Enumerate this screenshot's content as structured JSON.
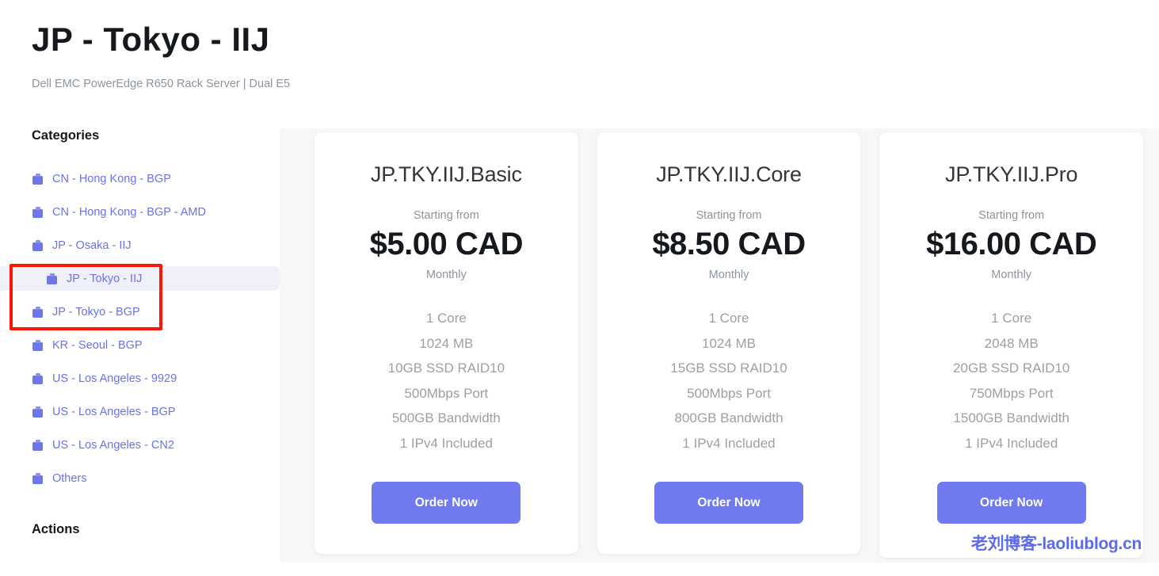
{
  "header": {
    "title": "JP - Tokyo - IIJ",
    "subtitle": "Dell EMC PowerEdge R650 Rack Server | Dual E5"
  },
  "sidebar": {
    "categories_heading": "Categories",
    "actions_heading": "Actions",
    "icon": "briefcase-icon",
    "items": [
      {
        "label": "CN - Hong Kong - BGP",
        "active": false
      },
      {
        "label": "CN - Hong Kong - BGP - AMD",
        "active": false
      },
      {
        "label": "JP - Osaka - IIJ",
        "active": false
      },
      {
        "label": "JP - Tokyo - IIJ",
        "active": true
      },
      {
        "label": "JP - Tokyo - BGP",
        "active": false
      },
      {
        "label": "KR - Seoul - BGP",
        "active": false
      },
      {
        "label": "US - Los Angeles - 9929",
        "active": false
      },
      {
        "label": "US - Los Angeles - BGP",
        "active": false
      },
      {
        "label": "US - Los Angeles - CN2",
        "active": false
      },
      {
        "label": "Others",
        "active": false
      }
    ]
  },
  "plans": [
    {
      "name": "JP.TKY.IIJ.Basic",
      "starting_label": "Starting from",
      "price": "$5.00 CAD",
      "cycle": "Monthly",
      "specs": [
        "1 Core",
        "1024 MB",
        "10GB SSD RAID10",
        "500Mbps Port",
        "500GB Bandwidth",
        "1 IPv4 Included"
      ],
      "order_label": "Order Now"
    },
    {
      "name": "JP.TKY.IIJ.Core",
      "starting_label": "Starting from",
      "price": "$8.50 CAD",
      "cycle": "Monthly",
      "specs": [
        "1 Core",
        "1024 MB",
        "15GB SSD RAID10",
        "500Mbps Port",
        "800GB Bandwidth",
        "1 IPv4 Included"
      ],
      "order_label": "Order Now"
    },
    {
      "name": "JP.TKY.IIJ.Pro",
      "starting_label": "Starting from",
      "price": "$16.00 CAD",
      "cycle": "Monthly",
      "specs": [
        "1 Core",
        "2048 MB",
        "20GB SSD RAID10",
        "750Mbps Port",
        "1500GB Bandwidth",
        "1 IPv4 Included"
      ],
      "order_label": "Order Now"
    }
  ],
  "watermark": {
    "text": "老刘博客-laoliublog.cn"
  },
  "colors": {
    "accent": "#7179ef",
    "link": "#6b72e8",
    "annotation": "#fb1708",
    "active_row_bg": "#f0f0fa",
    "plans_bg": "#f7f7f8",
    "muted_text": "#9aa0a8"
  }
}
